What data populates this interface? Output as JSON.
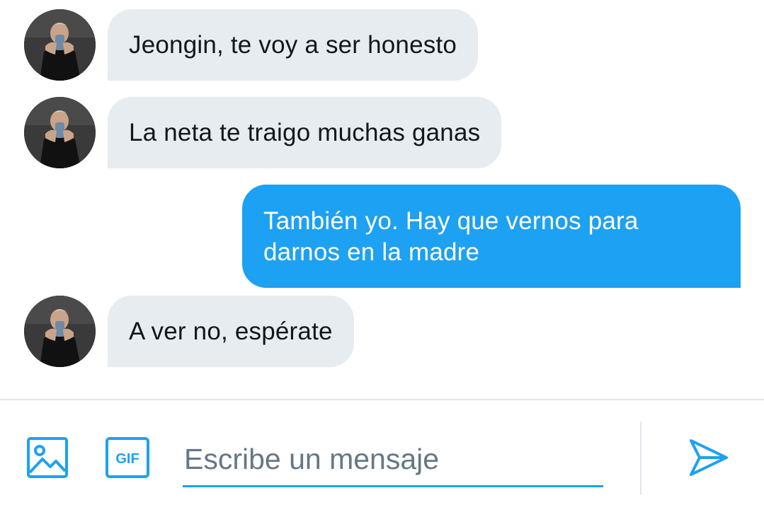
{
  "conversation": {
    "messages": [
      {
        "direction": "incoming",
        "text": "Jeongin, te voy a ser honesto"
      },
      {
        "direction": "incoming",
        "text": "La neta te traigo muchas ganas"
      },
      {
        "direction": "outgoing",
        "text": "También yo. Hay que vernos para darnos en la madre"
      },
      {
        "direction": "incoming",
        "text": "A ver no, espérate"
      }
    ]
  },
  "composer": {
    "placeholder": "Escribe un mensaje",
    "value": "",
    "icons": {
      "media": "image-icon",
      "gif": "gif-icon",
      "send": "send-icon"
    },
    "gif_label": "GIF"
  },
  "colors": {
    "accent": "#1da1f2",
    "incoming_bubble": "#e6ecf0",
    "outgoing_text": "#ffffff",
    "placeholder": "#657786",
    "divider": "#e1e8ed"
  }
}
